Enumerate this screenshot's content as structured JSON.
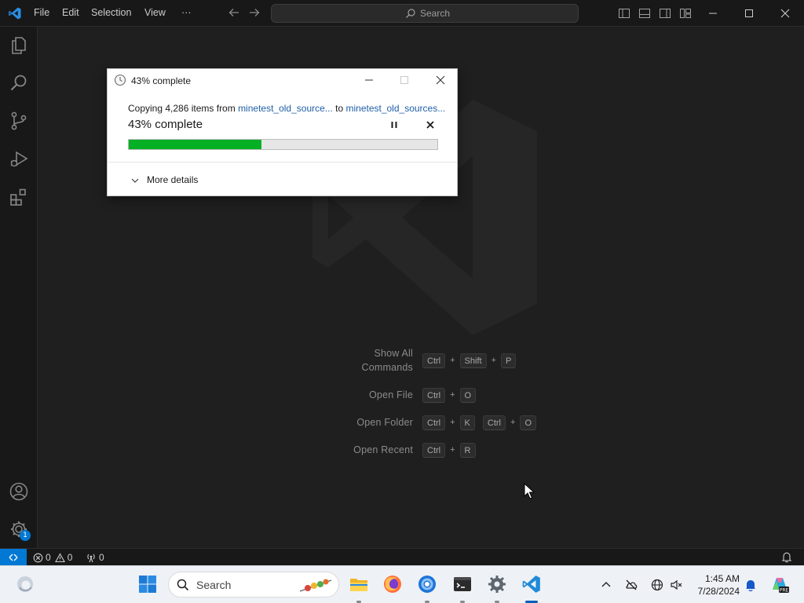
{
  "titlebar": {
    "menu": [
      "File",
      "Edit",
      "Selection",
      "View",
      "···"
    ],
    "search_placeholder": "Search"
  },
  "welcome": {
    "shortcuts": [
      {
        "label_line1": "Show All",
        "label_line2": "Commands",
        "keys": [
          "Ctrl",
          "+",
          "Shift",
          "+",
          "P"
        ]
      },
      {
        "label": "Open File",
        "keys": [
          "Ctrl",
          "+",
          "O"
        ]
      },
      {
        "label": "Open Folder",
        "keys": [
          "Ctrl",
          "+",
          "K"
        ],
        "keys2": [
          "Ctrl",
          "+",
          "O"
        ]
      },
      {
        "label": "Open Recent",
        "keys": [
          "Ctrl",
          "+",
          "R"
        ]
      }
    ]
  },
  "activitybar": {
    "settings_badge": "1"
  },
  "statusbar": {
    "errors": "0",
    "warnings": "0",
    "ports": "0"
  },
  "dialog": {
    "title": "43% complete",
    "copy_prefix": "Copying 4,286 items from ",
    "source": "minetest_old_source...",
    "to_text": " to ",
    "destination": "minetest_old_sources...",
    "status": "43% complete",
    "progress_fraction": 0.43,
    "more_details": "More details",
    "progress_color": "#06b025"
  },
  "taskbar": {
    "search_label": "Search",
    "time": "1:45 AM",
    "date": "7/28/2024"
  },
  "colors": {
    "accent": "#0078d4",
    "editor_bg": "#1f1f1f",
    "chrome_bg": "#181818"
  }
}
